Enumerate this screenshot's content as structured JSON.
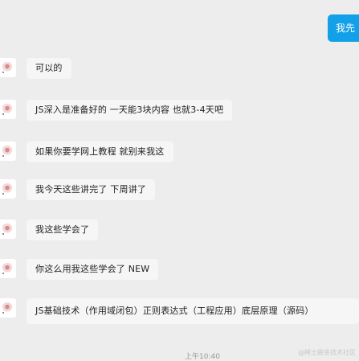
{
  "outgoing": {
    "text": "我先"
  },
  "messages": [
    {
      "text": "可以的"
    },
    {
      "text": "JS深入是准备好的 一天能3块内容 也就3-4天吧"
    },
    {
      "text": "如果你要学网上教程 就别来我这"
    },
    {
      "text": "我今天这些讲完了 下周讲了"
    },
    {
      "text": "我这些学会了"
    },
    {
      "text": "你这么用我这些学会了 NEW"
    },
    {
      "text": "JS基础技术（作用域闭包）正则表达式（工程应用）底层原理（源码）"
    }
  ],
  "footer": {
    "time": "上午10:40",
    "watermark": "@稀土掘金技术社区"
  }
}
